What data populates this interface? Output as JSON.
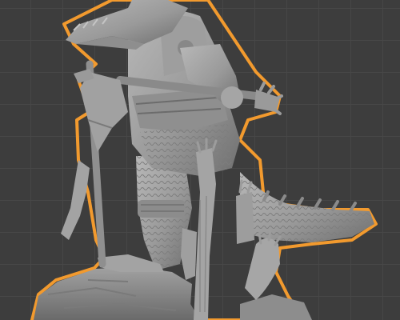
{
  "viewport": {
    "name": "3d-viewport",
    "background_color": "#3d3d3d",
    "grid_color": "#474747"
  },
  "model": {
    "subject": "crocodile-warrior-miniature-sculpt",
    "state": "selected",
    "mesh_color": "#a6a6a6",
    "shadow_color": "#6e6e6e",
    "selection_outline_color": "#f29a2e"
  }
}
